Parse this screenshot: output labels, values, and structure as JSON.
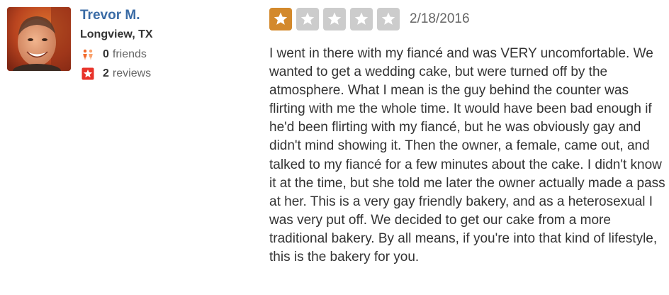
{
  "user": {
    "name": "Trevor M.",
    "location": "Longview, TX",
    "friends_count": "0",
    "friends_label": "friends",
    "reviews_count": "2",
    "reviews_label": "reviews"
  },
  "review": {
    "rating": 1,
    "rating_max": 5,
    "date": "2/18/2016",
    "text": "I went in there with my fiancé and was VERY uncomfortable. We wanted to get a wedding cake, but were turned off by the atmosphere. What I mean is the guy behind the counter was flirting with me the whole time. It would have been bad enough if he'd been flirting with my fiancé, but he was obviously gay and didn't mind showing it. Then the owner, a female, came out, and talked to my fiancé for a few minutes about the cake. I didn't know it at the time, but she told me later the owner actually made a pass at her. This is a very gay friendly bakery, and as a heterosexual I was very put off. We decided to get our cake from a more traditional bakery. By all means, if you're into that kind of lifestyle, this is the bakery for you."
  },
  "icons": {
    "friends": "friends-icon",
    "reviews": "review-star-icon",
    "rating_star": "star-icon"
  },
  "colors": {
    "user_name": "#3a6ba5",
    "star_filled": "#d3892c",
    "star_empty": "#cccccc",
    "friends_icon": "#f26b2c",
    "reviews_icon": "#e8332a"
  }
}
